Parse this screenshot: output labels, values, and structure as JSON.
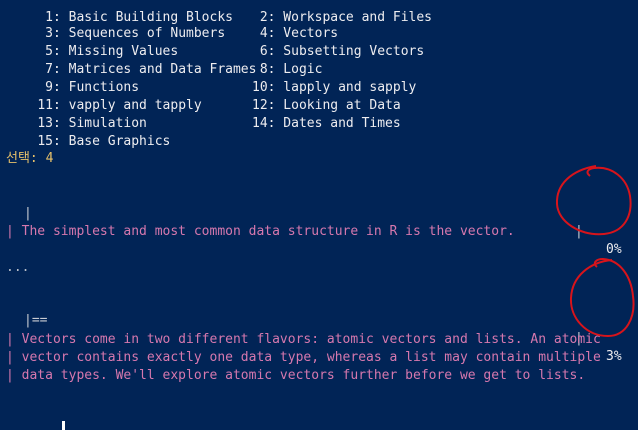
{
  "menu": {
    "rows": [
      {
        "left": " 1: Basic Building Blocks",
        "right": " 2: Workspace and Files"
      },
      {
        "left": " 3: Sequences of Numbers",
        "right": " 4: Vectors"
      },
      {
        "left": " 5: Missing Values",
        "right": " 6: Subsetting Vectors"
      },
      {
        "left": " 7: Matrices and Data Frames",
        "right": " 8: Logic"
      },
      {
        "left": " 9: Functions",
        "right": "10: lapply and sapply"
      },
      {
        "left": "11: vapply and tapply",
        "right": "12: Looking at Data"
      },
      {
        "left": "13: Simulation",
        "right": "14: Dates and Times"
      },
      {
        "left": "15: Base Graphics",
        "right": ""
      }
    ]
  },
  "selection": {
    "prompt": "선택: 4"
  },
  "progress": [
    {
      "bar": "|",
      "right_pipe": "|",
      "percent_text": "0%",
      "percent": 0
    },
    {
      "bar": "|==",
      "right_pipe": "|",
      "percent_text": "3%",
      "percent": 3
    }
  ],
  "messages": [
    {
      "lines": [
        "| The simplest and most common data structure in R is the vector."
      ]
    },
    {
      "lines": [
        "| Vectors come in two different flavors: atomic vectors and lists. An atomic",
        "| vector contains exactly one data type, whereas a list may contain multiple",
        "| data types. We'll explore atomic vectors further before we get to lists."
      ]
    }
  ],
  "continue_prompts": [
    "...",
    "..."
  ],
  "annotation_color": "#d8141b",
  "colors": {
    "background": "#012456",
    "text": "#eeedf0",
    "prompt": "#e5c06a",
    "message": "#d678ae"
  }
}
